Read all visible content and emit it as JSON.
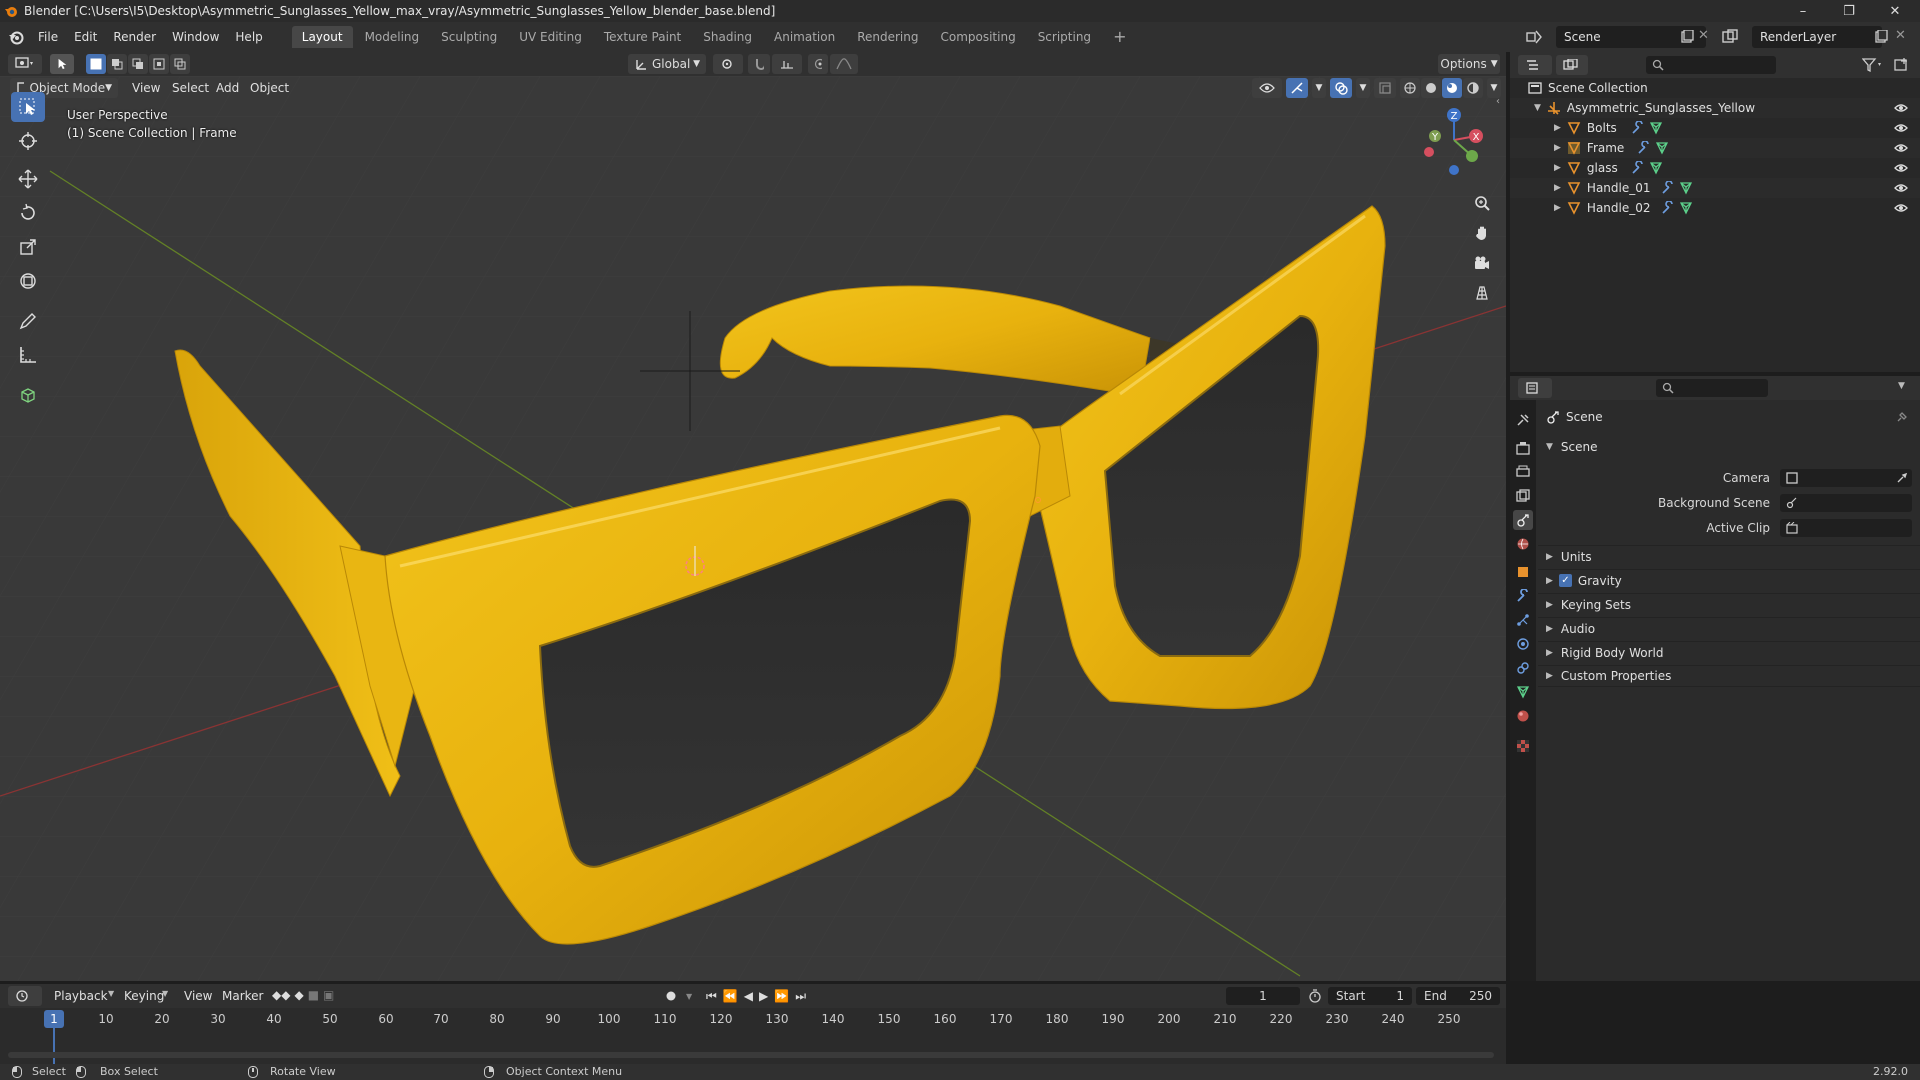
{
  "window": {
    "title": "Blender [C:\\Users\\I5\\Desktop\\Asymmetric_Sunglasses_Yellow_max_vray/Asymmetric_Sunglasses_Yellow_blender_base.blend]"
  },
  "menu": [
    "File",
    "Edit",
    "Render",
    "Window",
    "Help"
  ],
  "workspaces": [
    "Layout",
    "Modeling",
    "Sculpting",
    "UV Editing",
    "Texture Paint",
    "Shading",
    "Animation",
    "Rendering",
    "Compositing",
    "Scripting"
  ],
  "scene_name": "Scene",
  "view_layer": "RenderLayer",
  "viewport": {
    "transform_orientation": "Global",
    "options_label": "Options",
    "mode": "Object Mode",
    "header_menu": [
      "View",
      "Select",
      "Add",
      "Object"
    ],
    "perspective_label": "User Perspective",
    "collection_label": "(1) Scene Collection | Frame",
    "gizmo_axes": {
      "x": "X",
      "y": "Y",
      "z": "Z"
    },
    "accent_color": "#4772b3",
    "object_color": "#e8b20e"
  },
  "outliner": {
    "root": "Scene Collection",
    "collection": "Asymmetric_Sunglasses_Yellow",
    "objects": [
      "Bolts",
      "Frame",
      "glass",
      "Handle_01",
      "Handle_02"
    ]
  },
  "properties": {
    "context": "Scene",
    "panel_title": "Scene",
    "fields": {
      "camera_label": "Camera",
      "background_scene_label": "Background Scene",
      "active_clip_label": "Active Clip"
    },
    "subpanels": [
      "Units",
      "Gravity",
      "Keying Sets",
      "Audio",
      "Rigid Body World",
      "Custom Properties"
    ],
    "gravity_enabled": true
  },
  "timeline": {
    "menus": [
      "Playback",
      "Keying",
      "View",
      "Marker"
    ],
    "current_frame": "1",
    "start_label": "Start",
    "start_frame": "1",
    "end_label": "End",
    "end_frame": "250",
    "ruler": [
      "1",
      "10",
      "20",
      "30",
      "40",
      "50",
      "60",
      "70",
      "80",
      "90",
      "100",
      "110",
      "120",
      "130",
      "140",
      "150",
      "160",
      "170",
      "180",
      "190",
      "200",
      "210",
      "220",
      "230",
      "240",
      "250"
    ]
  },
  "statusbar": {
    "select": "Select",
    "box_select": "Box Select",
    "rotate_view": "Rotate View",
    "context_menu": "Object Context Menu",
    "version": "2.92.0"
  }
}
